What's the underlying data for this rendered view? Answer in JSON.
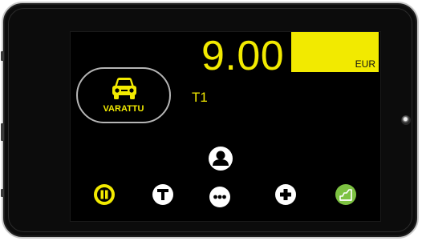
{
  "meter": {
    "fare": "9.00",
    "currency": "EUR",
    "tariff": "T1"
  },
  "status": {
    "label": "VARATTU",
    "icon": "car-icon"
  },
  "toolbar": {
    "items": [
      {
        "name": "pause-icon",
        "color": "#f2ea00"
      },
      {
        "name": "tariff-t-icon",
        "color": "#ffffff"
      },
      {
        "name": "more-icon",
        "color": "#ffffff"
      },
      {
        "name": "plus-icon",
        "color": "#ffffff"
      },
      {
        "name": "receipt-graph-icon",
        "color": "#7dc242"
      }
    ]
  },
  "driver": {
    "icon": "user-icon"
  },
  "colors": {
    "accent_yellow": "#f2ea00",
    "accent_green": "#7dc242",
    "screen_background": "#000000"
  }
}
